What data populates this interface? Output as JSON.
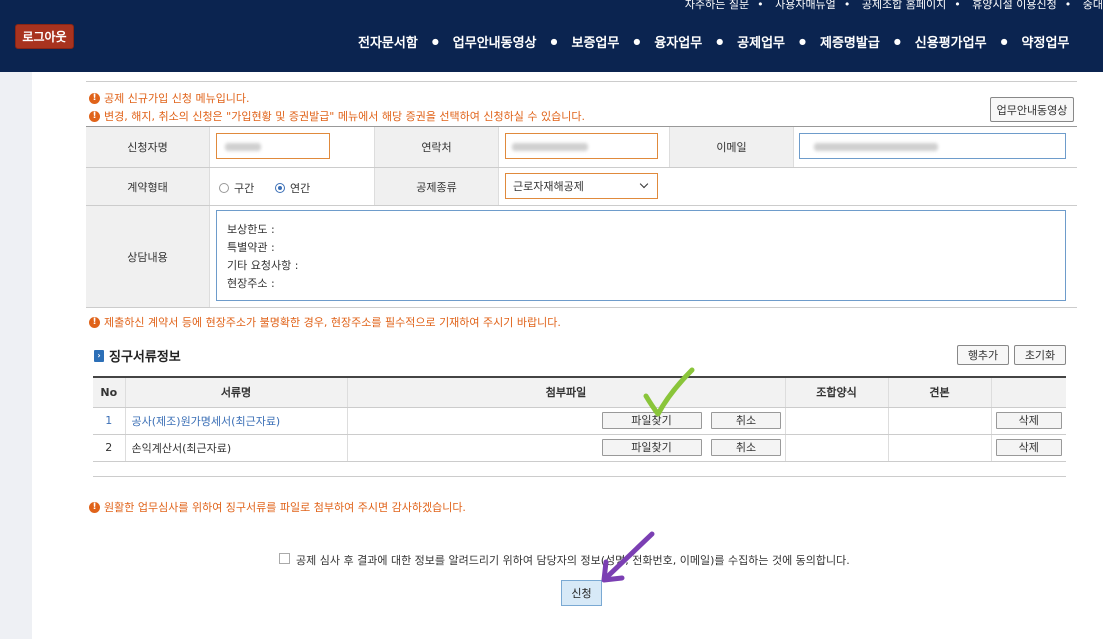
{
  "header": {
    "top_links": [
      "자주하는 질문",
      "사용자매뉴얼",
      "공제조합 홈페이지",
      "휴양시설 이용신청",
      "중대"
    ],
    "logout_label": "로그아웃",
    "nav": [
      "전자문서함",
      "업무안내동영상",
      "보증업무",
      "융자업무",
      "공제업무",
      "제증명발급",
      "신용평가업무",
      "약정업무"
    ]
  },
  "notices": {
    "top1": "공제 신규가입 신청 메뉴입니다.",
    "top2": "변경, 해지, 취소의 신청은 \"가입현황 및 증권발급\" 메뉴에서 해당 증권을 선택하여 신청하실 수 있습니다.",
    "address": "제출하신 계약서 등에 현장주소가 불명확한 경우, 현장주소를 필수적으로 기재하여 주시기 바랍니다.",
    "bottom": "원활한 업무심사를 위하여 징구서류를 파일로 첨부하여 주시면 감사하겠습니다."
  },
  "guide_video_label": "업무안내동영상",
  "form": {
    "applicant_label": "신청자명",
    "contact_label": "연락처",
    "email_label": "이메일",
    "contract_type_label": "계약형태",
    "contract_options": [
      "구간",
      "연간"
    ],
    "contract_selected": "연간",
    "deduction_type_label": "공제종류",
    "deduction_type_value": "근로자재해공제",
    "consult_label": "상담내용",
    "consult_text": "보상한도 :\n특별약관 :\n기타 요청사항 :\n현장주소 :"
  },
  "docs": {
    "title": "징구서류정보",
    "add_row_label": "행추가",
    "reset_label": "초기화",
    "columns": [
      "No",
      "서류명",
      "첨부파일",
      "조합양식",
      "견본"
    ],
    "rows": [
      {
        "no": "1",
        "name": "공사(제조)원가명세서(최근자료)",
        "find": "파일찾기",
        "cancel": "취소",
        "delete": "삭제"
      },
      {
        "no": "2",
        "name": "손익계산서(최근자료)",
        "find": "파일찾기",
        "cancel": "취소",
        "delete": "삭제"
      }
    ]
  },
  "agree_text": "공제 심사 후 결과에 대한 정보를 알려드리기 위하여 담당자의 정보(성명, 전화번호, 이메일)를 수집하는 것에 동의합니다.",
  "submit_label": "신청",
  "colors": {
    "header_bg": "#0b2450",
    "logout_bg": "#a8331f",
    "notice": "#e0631a",
    "link": "#3b6fb6",
    "annotation_green": "#8ac53a",
    "annotation_purple": "#7b3fb3"
  }
}
